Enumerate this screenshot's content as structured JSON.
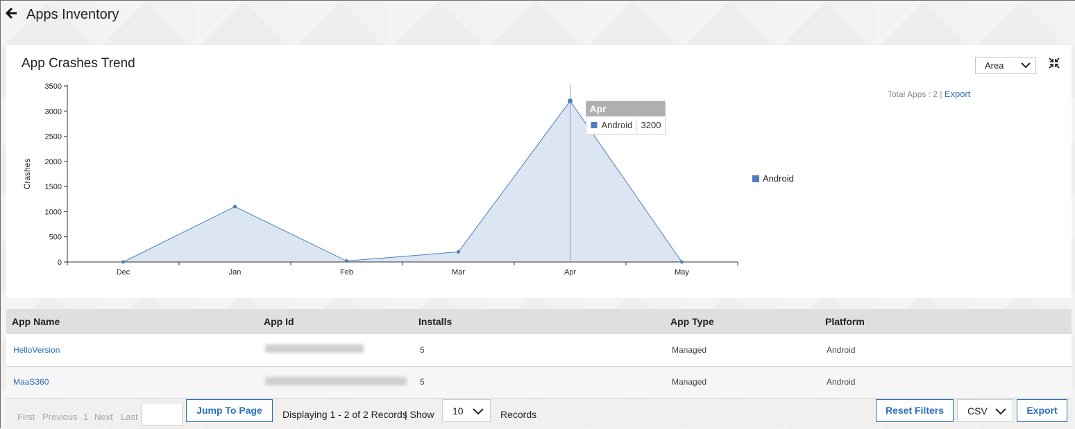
{
  "header": {
    "title": "Apps Inventory"
  },
  "chart_panel": {
    "title": "App Crashes Trend",
    "chart_type_select": "Area",
    "total_apps_label": "Total Apps : 2 |",
    "export_link": "Export",
    "legend": [
      {
        "name": "Android",
        "color": "#4b7ec0"
      }
    ],
    "tooltip": {
      "title": "Apr",
      "series": "Android",
      "value": "3200"
    }
  },
  "chart_data": {
    "type": "area",
    "categories": [
      "Dec",
      "Jan",
      "Feb",
      "Mar",
      "Apr",
      "May"
    ],
    "series": [
      {
        "name": "Android",
        "values": [
          0,
          1100,
          20,
          200,
          3200,
          0
        ]
      }
    ],
    "ylabel": "Crashes",
    "xlabel": "",
    "ylim": [
      0,
      3500
    ],
    "yticks": [
      0,
      500,
      1000,
      1500,
      2000,
      2500,
      3000,
      3500
    ],
    "legend_position": "right",
    "grid": false,
    "colors": {
      "line": "#4b7ec0",
      "fill": "#dce5f2",
      "crosshair": "#8a9ab0"
    }
  },
  "table": {
    "columns": [
      "App Name",
      "App Id",
      "Installs",
      "App Type",
      "Platform"
    ],
    "rows": [
      {
        "app_name": "HelloVersion",
        "installs": "5",
        "app_type": "Managed",
        "platform": "Android"
      },
      {
        "app_name": "MaaS360",
        "installs": "5",
        "app_type": "Managed",
        "platform": "Android"
      }
    ]
  },
  "pager": {
    "first": "First",
    "previous": "Previous",
    "page": "1",
    "next": "Next",
    "last": "Last",
    "jump_button": "Jump To Page",
    "displaying": "Displaying 1 - 2 of 2 Records",
    "show_label": "| Show",
    "page_size": "10",
    "records_label": "Records",
    "reset_button": "Reset Filters",
    "format_select": "CSV",
    "export_button": "Export"
  }
}
